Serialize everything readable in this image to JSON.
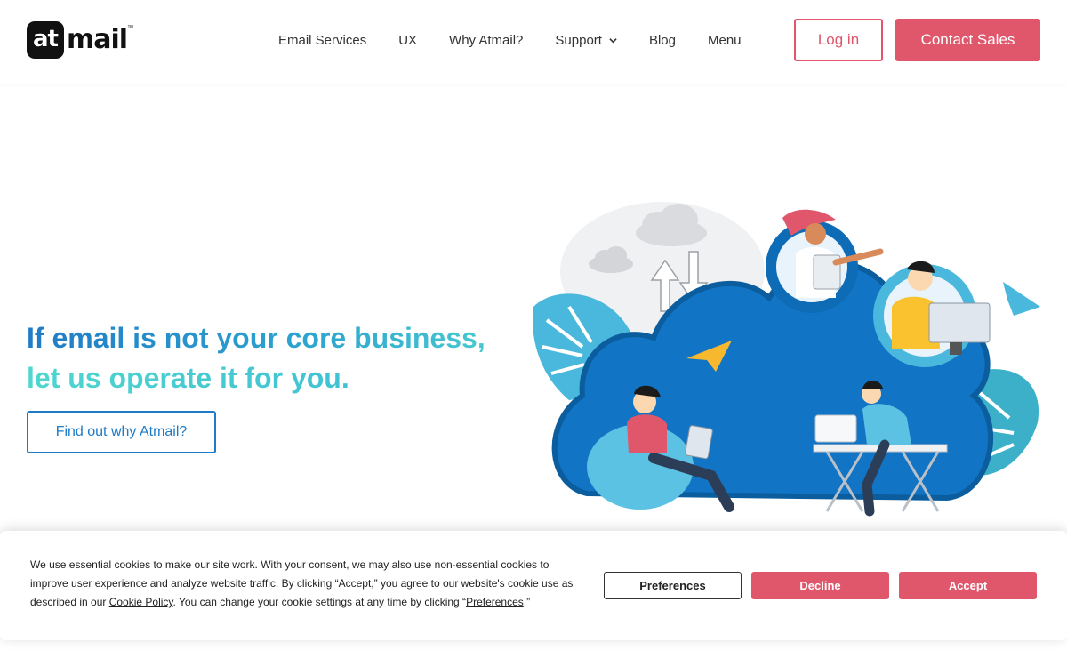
{
  "brand": {
    "logo_at": "at",
    "logo_mail": "mail",
    "logo_tm": "™"
  },
  "nav": {
    "items": [
      {
        "label": "Email Services"
      },
      {
        "label": "UX"
      },
      {
        "label": "Why Atmail?"
      },
      {
        "label": "Support",
        "icon": "chevron-down-icon"
      },
      {
        "label": "Blog"
      },
      {
        "label": "Menu"
      }
    ],
    "login_label": "Log in",
    "sales_label": "Contact Sales"
  },
  "hero": {
    "title_line1": "If email is not your core business,",
    "title_line2": "let us operate it for you.",
    "cta_label": "Find out why Atmail?"
  },
  "cookie": {
    "text_part1": "We use essential cookies to make our site work. With your consent, we may also use non-essential cookies to improve user experience and analyze website traffic. By clicking “Accept,” you agree to our website's cookie use as described in our ",
    "policy_link": "Cookie Policy",
    "text_part2": ". You can change your cookie settings at any time by clicking “",
    "pref_link": "Preferences",
    "text_part3": ".”",
    "preferences_label": "Preferences",
    "decline_label": "Decline",
    "accept_label": "Accept"
  },
  "colors": {
    "accent_pink": "#e0566a",
    "brand_blue": "#1f7bc6",
    "teal": "#4fd0d0"
  }
}
